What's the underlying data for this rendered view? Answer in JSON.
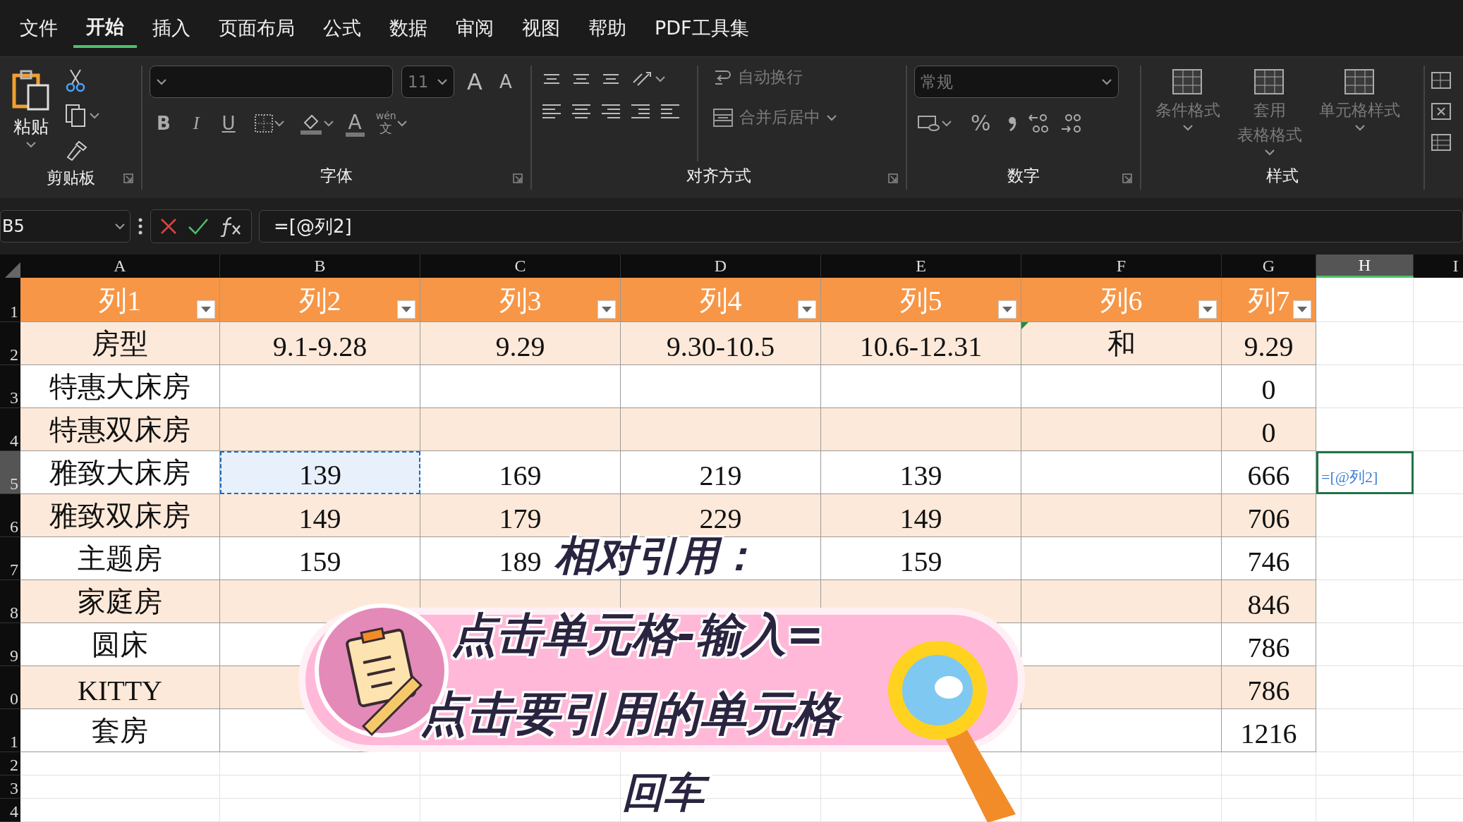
{
  "menu": [
    {
      "label": "文件",
      "selected": false
    },
    {
      "label": "开始",
      "selected": true
    },
    {
      "label": "插入",
      "selected": false
    },
    {
      "label": "页面布局",
      "selected": false
    },
    {
      "label": "公式",
      "selected": false
    },
    {
      "label": "数据",
      "selected": false
    },
    {
      "label": "审阅",
      "selected": false
    },
    {
      "label": "视图",
      "selected": false
    },
    {
      "label": "帮助",
      "selected": false
    },
    {
      "label": "PDF工具集",
      "selected": false
    }
  ],
  "ribbon": {
    "clipboard": {
      "paste": "粘贴",
      "label": "剪贴板"
    },
    "font": {
      "size": "11",
      "grow": "A",
      "shrink": "A",
      "bold": "B",
      "italic": "I",
      "underline": "U",
      "font_color": "A",
      "phonetic_top": "wén",
      "phonetic_bottom": "文",
      "label": "字体"
    },
    "alignment": {
      "wrap": {
        "label": "自动换行",
        "disabled": true
      },
      "merge": {
        "label": "合并后居中",
        "disabled": true
      },
      "label": "对齐方式"
    },
    "number": {
      "format": {
        "value": "常规",
        "disabled": true
      },
      "percent": "%",
      "label": "数字"
    },
    "styles": {
      "buttons": [
        {
          "lines": [
            "条件格式"
          ],
          "disabled": true
        },
        {
          "lines": [
            "套用",
            "表格格式"
          ],
          "disabled": true
        },
        {
          "lines": [
            "单元格样式"
          ],
          "disabled": true
        }
      ],
      "label": "样式"
    }
  },
  "formula_bar": {
    "name_box": "B5",
    "formula": "=[@列2]"
  },
  "columns": [
    {
      "letter": "A",
      "selected": false
    },
    {
      "letter": "B",
      "selected": false
    },
    {
      "letter": "C",
      "selected": false
    },
    {
      "letter": "D",
      "selected": false
    },
    {
      "letter": "E",
      "selected": false
    },
    {
      "letter": "F",
      "selected": false
    },
    {
      "letter": "G",
      "selected": false
    },
    {
      "letter": "H",
      "selected": true
    },
    {
      "letter": "I",
      "selected": false
    }
  ],
  "rows": [
    {
      "header": "1",
      "kind": "table-header",
      "selected": false,
      "cells": [
        {
          "text": "列1",
          "filter": true
        },
        {
          "text": "列2",
          "filter": true
        },
        {
          "text": "列3",
          "filter": true
        },
        {
          "text": "列4",
          "filter": true
        },
        {
          "text": "列5",
          "filter": true
        },
        {
          "text": "列6",
          "filter": true
        },
        {
          "text": "列7",
          "filter": true
        }
      ]
    },
    {
      "header": "2",
      "kind": "band",
      "selected": false,
      "cells": [
        {
          "text": "房型"
        },
        {
          "text": "9.1-9.28"
        },
        {
          "text": "9.29"
        },
        {
          "text": "9.30-10.5"
        },
        {
          "text": "10.6-12.31"
        },
        {
          "text": "和",
          "error_flag": true
        },
        {
          "text": "9.29"
        }
      ]
    },
    {
      "header": "3",
      "kind": "plain",
      "selected": false,
      "cells": [
        {
          "text": "特惠大床房"
        },
        null,
        null,
        null,
        null,
        null,
        {
          "text": "0"
        }
      ]
    },
    {
      "header": "4",
      "kind": "band",
      "selected": false,
      "cells": [
        {
          "text": "特惠双床房"
        },
        null,
        null,
        null,
        null,
        null,
        {
          "text": "0"
        }
      ]
    },
    {
      "header": "5",
      "kind": "plain",
      "selected": true,
      "cells": [
        {
          "text": "雅致大床房"
        },
        {
          "text": "139",
          "copied": true
        },
        {
          "text": "169"
        },
        {
          "text": "219"
        },
        {
          "text": "139"
        },
        null,
        {
          "text": "666"
        },
        {
          "text": "=[@列2]",
          "editing": true
        }
      ]
    },
    {
      "header": "6",
      "kind": "band",
      "selected": false,
      "cells": [
        {
          "text": "雅致双床房"
        },
        {
          "text": "149"
        },
        {
          "text": "179"
        },
        {
          "text": "229"
        },
        {
          "text": "149"
        },
        null,
        {
          "text": "706"
        }
      ]
    },
    {
      "header": "7",
      "kind": "plain",
      "selected": false,
      "cells": [
        {
          "text": "主题房"
        },
        {
          "text": "159"
        },
        {
          "text": "189"
        },
        null,
        {
          "text": "159"
        },
        null,
        {
          "text": "746"
        }
      ]
    },
    {
      "header": "8",
      "kind": "band",
      "selected": false,
      "cells": [
        {
          "text": "家庭房"
        },
        null,
        null,
        null,
        null,
        null,
        {
          "text": "846"
        }
      ]
    },
    {
      "header": "9",
      "kind": "plain",
      "selected": false,
      "cells": [
        {
          "text": "圆床"
        },
        null,
        null,
        null,
        null,
        null,
        {
          "text": "786"
        }
      ]
    },
    {
      "header": "0",
      "kind": "band",
      "selected": false,
      "cells": [
        {
          "text": "KITTY"
        },
        null,
        null,
        null,
        null,
        null,
        {
          "text": "786"
        }
      ]
    },
    {
      "header": "1",
      "kind": "plain",
      "selected": false,
      "cells": [
        {
          "text": "套房"
        },
        null,
        null,
        null,
        null,
        null,
        {
          "text": "1216"
        }
      ]
    },
    {
      "header": "2",
      "kind": "empty",
      "selected": false
    },
    {
      "header": "3",
      "kind": "empty",
      "selected": false
    },
    {
      "header": "4",
      "kind": "empty",
      "selected": false
    }
  ],
  "caption": {
    "lines": [
      "相对引用：",
      "点击单元格-输入=",
      "点击要引用的单元格",
      "回车"
    ]
  }
}
